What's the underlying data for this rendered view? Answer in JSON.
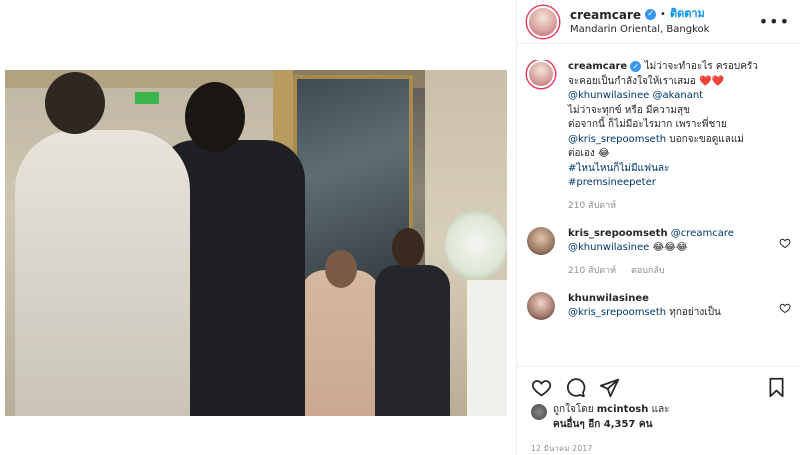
{
  "post": {
    "username": "creamcare",
    "follow_label": "ติดตาม",
    "location": "Mandarin Oriental, Bangkok"
  },
  "caption": {
    "username": "creamcare",
    "line1": "ไม่ว่าจะทำอะไร ครอบครัว",
    "line2": "จะคอยเป็นกำลังใจให้เราเสมอ",
    "hearts": "❤️❤️",
    "mention1": "@khunwilasinee",
    "mention2": "@akanant",
    "line3": "ไม่ว่าจะทุกข์ หรือ มีความสุข",
    "line4": "ต่อจากนี้ ก็ไม่มีอะไรมาก เพราะพี่ชาย",
    "mention3": "@kris_srepoomseth",
    "line5": " บอกจะขอดูแลแม่",
    "line6": "ต่อเอง 😂",
    "hashtag1": "#ไหนไหนก็ไม่มีแฟนละ",
    "hashtag2": "#premsineepeter",
    "time": "210 สัปดาห์"
  },
  "comments": [
    {
      "username": "kris_srepoomseth",
      "mention_a": "@creamcare",
      "mention_b": "@khunwilasinee",
      "text": " 😂😂😂",
      "time": "210 สัปดาห์",
      "reply_label": "ตอบกลับ"
    },
    {
      "username": "khunwilasinee",
      "mention_a": "@kris_srepoomseth",
      "text": " ทุกอย่างเป็น"
    }
  ],
  "likes": {
    "prefix": "ถูกใจโดย ",
    "user": "mcintosh",
    "and": " และ",
    "others": "คนอื่นๆ อีก 4,357 คน"
  },
  "date": "12 มีนาคม 2017",
  "icons": [
    "heart-icon",
    "comment-icon",
    "share-icon",
    "bookmark-icon",
    "more-icon",
    "verified-icon"
  ]
}
